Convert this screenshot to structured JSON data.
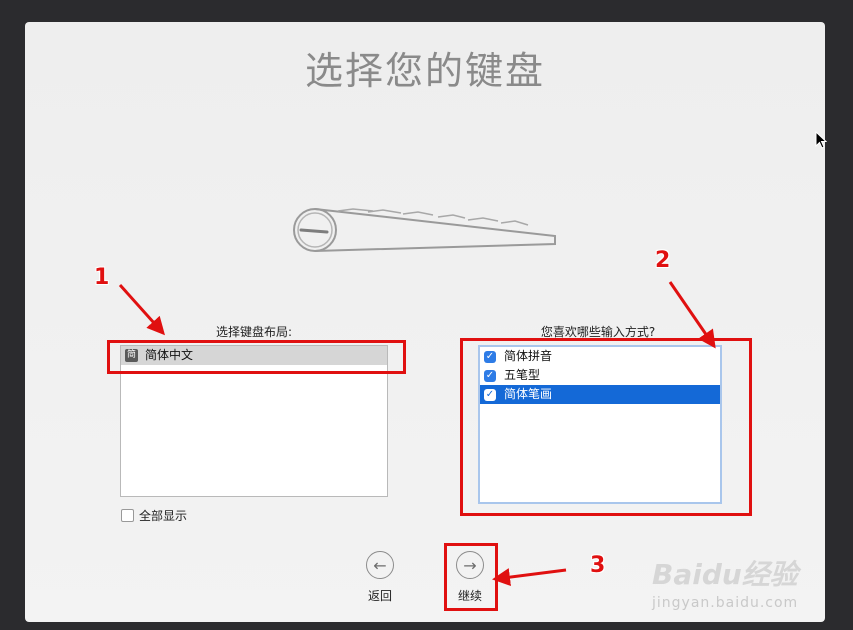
{
  "page": {
    "title": "选择您的键盘"
  },
  "layout_section": {
    "label": "选择键盘布局:",
    "items": [
      {
        "icon_text": "简",
        "label": "简体中文",
        "selected": true
      }
    ],
    "show_all_label": "全部显示"
  },
  "input_section": {
    "label": "您喜欢哪些输入方式?",
    "items": [
      {
        "label": "简体拼音",
        "checked": true,
        "highlighted": false
      },
      {
        "label": "五笔型",
        "checked": true,
        "highlighted": false
      },
      {
        "label": "简体笔画",
        "checked": true,
        "highlighted": true
      }
    ]
  },
  "nav": {
    "back_label": "返回",
    "continue_label": "继续"
  },
  "annotations": {
    "n1": "1",
    "n2": "2",
    "n3": "3"
  },
  "watermark": {
    "brand": "Baidu经验",
    "url": "jingyan.baidu.com"
  },
  "colors": {
    "highlight": "#1469d7",
    "annotation_red": "#e01010"
  }
}
